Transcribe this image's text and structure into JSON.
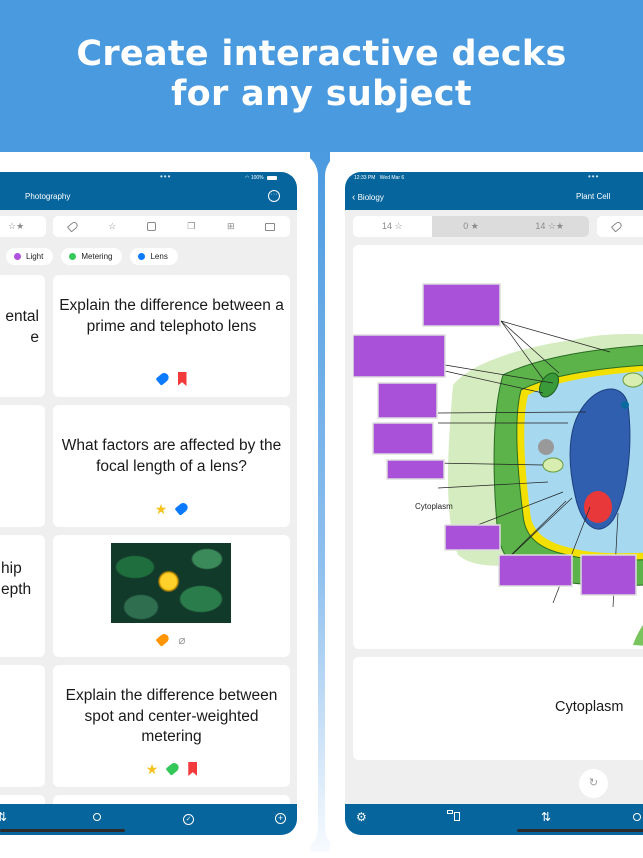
{
  "banner": {
    "line1": "Create interactive decks",
    "line2": "for any subject"
  },
  "left_device": {
    "status": {
      "battery": "100%"
    },
    "nav_title": "Photography",
    "toolbar": [
      {
        "icon": "star-filter-icon",
        "label": "☆★"
      },
      {
        "icon": "tag-icon",
        "label": "⬦"
      },
      {
        "icon": "star-icon",
        "label": "☆"
      },
      {
        "icon": "stack-icon",
        "label": "⌂"
      },
      {
        "icon": "cards-icon",
        "label": "❐"
      },
      {
        "icon": "table-icon",
        "label": "⊞"
      },
      {
        "icon": "comment-icon",
        "label": "💬"
      }
    ],
    "chips": [
      {
        "label": "Light",
        "color": "#af52de"
      },
      {
        "label": "Metering",
        "color": "#34c759"
      },
      {
        "label": "Lens",
        "color": "#0a7aff"
      }
    ],
    "left_column_fragments": [
      {
        "lines": [
          "ental",
          "e"
        ]
      },
      {
        "lines": []
      },
      {
        "lines": [
          "hip",
          "epth"
        ]
      },
      {
        "lines": []
      }
    ],
    "cards": [
      {
        "text": "Explain the difference between a prime and telephoto lens",
        "icons": [
          "tag-blue",
          "bookmark-red"
        ]
      },
      {
        "text": "What factors are affected by the focal length of a lens?",
        "icons": [
          "star-yellow",
          "tag-blue"
        ]
      },
      {
        "text": "",
        "image": "yellow-flower-photo",
        "icons": [
          "tag-orange",
          "paperclip"
        ]
      },
      {
        "text": "Explain the difference between spot and center-weighted metering",
        "icons": [
          "star-yellow",
          "tag-green",
          "bookmark-red"
        ]
      }
    ],
    "tabbar": [
      {
        "icon": "sort-icon",
        "glyph": "⇅"
      },
      {
        "icon": "search-icon",
        "glyph": "⌕"
      },
      {
        "icon": "check-circle-icon",
        "glyph": "✓"
      },
      {
        "icon": "add-circle-icon",
        "glyph": "+"
      }
    ]
  },
  "right_device": {
    "status": {
      "time": "12:33 PM",
      "date": "Wed Mar 6"
    },
    "back_label": "Biology",
    "nav_title": "Plant Cell",
    "segments": [
      {
        "label": "14 ☆",
        "active": false
      },
      {
        "label": "0 ★",
        "active": true
      },
      {
        "label": "14 ☆★",
        "active": true
      }
    ],
    "diagram": {
      "visible_label": "Cytoplasm",
      "hidden_label_count": 9
    },
    "answer": "Cytoplasm",
    "flip_glyph": "↻",
    "tabbar": [
      {
        "icon": "gear-icon",
        "glyph": "⚙"
      },
      {
        "icon": "layout-icon",
        "glyph": "▭"
      },
      {
        "icon": "sort-icon",
        "glyph": "⇅"
      },
      {
        "icon": "search-icon",
        "glyph": "⌕"
      }
    ]
  }
}
